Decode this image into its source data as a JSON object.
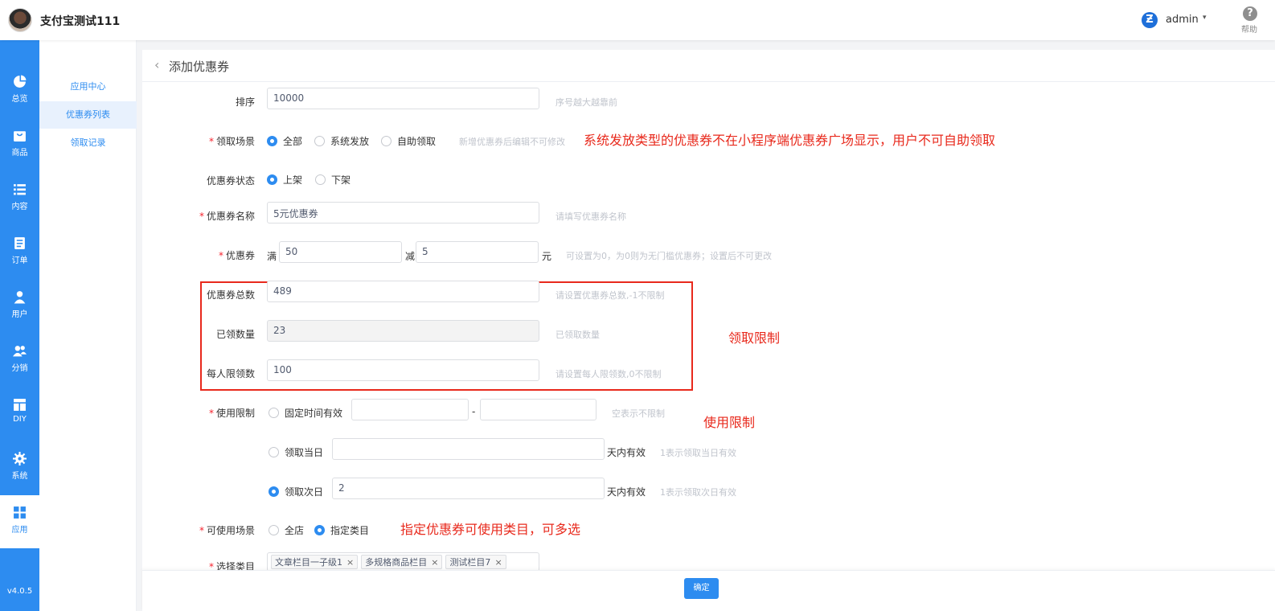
{
  "header": {
    "store_name": "支付宝测试111",
    "admin_name": "admin",
    "admin_caret": "▾",
    "help_label": "帮助",
    "help_glyph": "?",
    "admin_logo_glyph": "Ƶ"
  },
  "sidebar": {
    "items": [
      {
        "label": "总览",
        "icon": "pie-chart-icon"
      },
      {
        "label": "商品",
        "icon": "shop-icon"
      },
      {
        "label": "内容",
        "icon": "list-icon"
      },
      {
        "label": "订单",
        "icon": "document-icon"
      },
      {
        "label": "用户",
        "icon": "user-icon"
      },
      {
        "label": "分销",
        "icon": "users-icon"
      },
      {
        "label": "DIY",
        "icon": "layout-icon"
      },
      {
        "label": "系统",
        "icon": "gear-icon"
      },
      {
        "label": "应用",
        "icon": "apps-icon"
      }
    ],
    "active": "应用",
    "version": "v4.0.5",
    "accent": "#2d8cf0"
  },
  "submenu": {
    "items": [
      "应用中心",
      "优惠券列表",
      "领取记录"
    ],
    "active": "优惠券列表"
  },
  "page": {
    "back_glyph": "‹",
    "title": "添加优惠券"
  },
  "form": {
    "sort": {
      "label": "排序",
      "value": "10000",
      "hint": "序号越大越靠前"
    },
    "scene": {
      "label": "领取场景",
      "options": [
        "全部",
        "系统发放",
        "自助领取"
      ],
      "selected": "全部",
      "hint": "新增优惠券后编辑不可修改"
    },
    "status": {
      "label": "优惠券状态",
      "options": [
        "上架",
        "下架"
      ],
      "selected": "上架"
    },
    "name": {
      "label": "优惠券名称",
      "value": "5元优惠券",
      "hint": "请填写优惠券名称"
    },
    "coupon": {
      "label": "优惠券",
      "full_label": "满",
      "full_value": "50",
      "minus_label": "减",
      "minus_value": "5",
      "unit": "元",
      "hint": "可设置为0，为0则为无门槛优惠券；设置后不可更改"
    },
    "total": {
      "label": "优惠券总数",
      "value": "489",
      "hint": "请设置优惠券总数,-1不限制"
    },
    "received": {
      "label": "已领数量",
      "value": "23",
      "hint": "已领取数量"
    },
    "per_limit": {
      "label": "每人限领数",
      "value": "100",
      "hint": "请设置每人限领数,0不限制"
    },
    "use_limit": {
      "label": "使用限制",
      "fixed_label": "固定时间有效",
      "range_sep": "-",
      "range_hint": "空表示不限制",
      "same_day_label": "领取当日",
      "same_day_suffix": "天内有效",
      "same_day_hint": "1表示领取当日有效",
      "next_day_label": "领取次日",
      "next_day_value": "2",
      "next_day_suffix": "天内有效",
      "next_day_hint": "1表示领取次日有效",
      "selected": "领取次日"
    },
    "usable_scene": {
      "label": "可使用场景",
      "options": [
        "全店",
        "指定类目"
      ],
      "selected": "指定类目"
    },
    "category": {
      "label": "选择类目",
      "tags": [
        "文章栏目一子级1",
        "多规格商品栏目",
        "测试栏目7"
      ],
      "remove_glyph": "×"
    }
  },
  "annotations": {
    "scene_note": "系统发放类型的优惠券不在小程序端优惠券广场显示，用户不可自助领取",
    "limit_note": "领取限制",
    "use_note": "使用限制",
    "category_note": "指定优惠券可使用类目，可多选",
    "color": "#e8291c"
  },
  "footer": {
    "confirm_label": "确定"
  }
}
